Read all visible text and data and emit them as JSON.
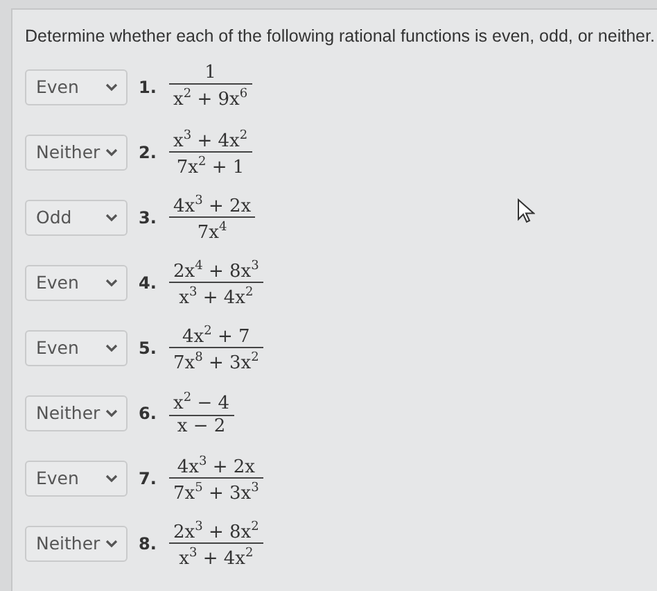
{
  "instructions": "Determine whether each of the following rational functions is even, odd, or neither.",
  "problems": [
    {
      "answer": "Even",
      "number": "1.",
      "numerator": "1",
      "denominator": "x$^{2}$ + 9x$^{6}$"
    },
    {
      "answer": "Neither",
      "number": "2.",
      "numerator": "x$^{3}$ + 4x$^{2}$",
      "denominator": "7x$^{2}$ + 1"
    },
    {
      "answer": "Odd",
      "number": "3.",
      "numerator": "4x$^{3}$ + 2x",
      "denominator": "7x$^{4}$"
    },
    {
      "answer": "Even",
      "number": "4.",
      "numerator": "2x$^{4}$ + 8x$^{3}$",
      "denominator": "x$^{3}$ + 4x$^{2}$"
    },
    {
      "answer": "Even",
      "number": "5.",
      "numerator": "4x$^{2}$ + 7",
      "denominator": "7x$^{8}$ + 3x$^{2}$"
    },
    {
      "answer": "Neither",
      "number": "6.",
      "numerator": "x$^{2}$ − 4",
      "denominator": "x − 2"
    },
    {
      "answer": "Even",
      "number": "7.",
      "numerator": "4x$^{3}$ + 2x",
      "denominator": "7x$^{5}$ + 3x$^{3}$"
    },
    {
      "answer": "Neither",
      "number": "8.",
      "numerator": "2x$^{3}$ + 8x$^{2}$",
      "denominator": "x$^{3}$ + 4x$^{2}$"
    }
  ]
}
